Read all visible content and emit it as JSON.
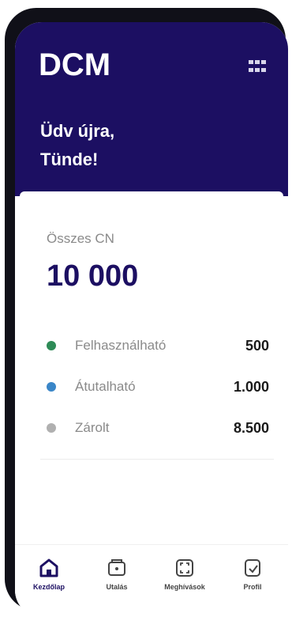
{
  "app": {
    "logo": "DCM"
  },
  "header": {
    "greeting_line1": "Üdv újra,",
    "greeting_line2": "Tünde!"
  },
  "balance": {
    "label": "Összes CN",
    "total": "10 000",
    "items": [
      {
        "label": "Felhasználható",
        "value": "500",
        "color": "#2e8b57"
      },
      {
        "label": "Átutalható",
        "value": "1.000",
        "color": "#3a86c8"
      },
      {
        "label": "Zárolt",
        "value": "8.500",
        "color": "#b0b0b0"
      }
    ]
  },
  "nav": {
    "items": [
      {
        "label": "Kezdőlap",
        "icon": "home-icon",
        "active": true
      },
      {
        "label": "Utalás",
        "icon": "wallet-icon",
        "active": false
      },
      {
        "label": "Meghívások",
        "icon": "invite-icon",
        "active": false
      },
      {
        "label": "Profil",
        "icon": "profile-icon",
        "active": false
      }
    ]
  },
  "colors": {
    "brand": "#1c0f62"
  }
}
